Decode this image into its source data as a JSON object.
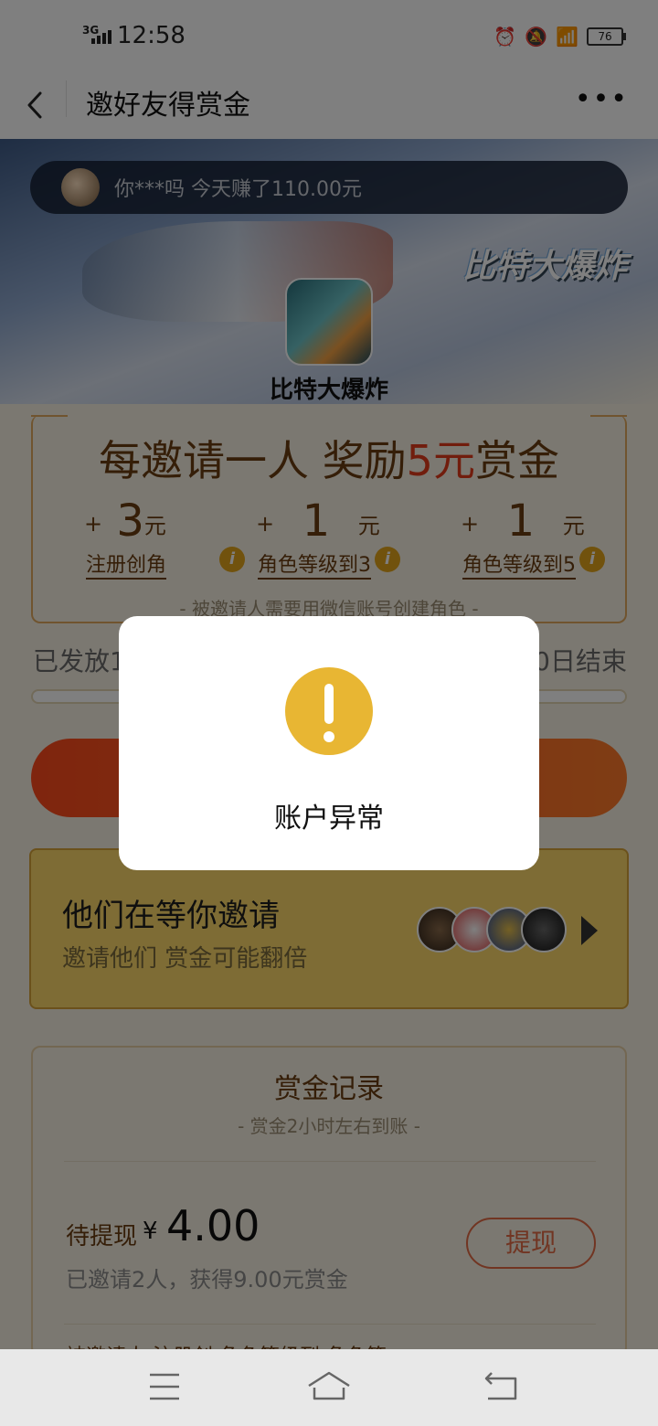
{
  "status_bar": {
    "network": "3G",
    "time": "12:58",
    "battery": "76"
  },
  "nav": {
    "title": "邀好友得赏金",
    "more": "•••"
  },
  "banner": {
    "ticker_text": "你***吗 今天赚了110.00元",
    "game_logo_text": "比特大爆炸",
    "app_name": "比特大爆炸"
  },
  "reward": {
    "headline_pre": "每邀请一人 奖励",
    "headline_amount": "5元",
    "headline_post": "赏金",
    "items": [
      {
        "plus": "+",
        "amount": "3",
        "unit": "元",
        "label": "注册创角"
      },
      {
        "plus": "+",
        "amount": "1",
        "unit": "元",
        "label": "角色等级到3"
      },
      {
        "plus": "+",
        "amount": "1",
        "unit": "元",
        "label": "角色等级到5"
      }
    ],
    "info_glyph": "i",
    "note": "- 被邀请人需要用微信账号创建角色 -"
  },
  "progress": {
    "left_text": "已发放1",
    "right_text": "0日结束"
  },
  "waiting": {
    "title": "他们在等你邀请",
    "subtitle": "邀请他们 赏金可能翻倍"
  },
  "records": {
    "title": "赏金记录",
    "subtitle": "- 赏金2小时左右到账 -",
    "pending_label": "待提现",
    "currency": "¥",
    "pending_amount": "4.00",
    "summary": "已邀请2人，获得9.00元赏金",
    "withdraw_label": "提现",
    "headers_partial": "被邀请人          注册创     角色等级到     角色等"
  },
  "modal": {
    "message": "账户异常"
  },
  "colors": {
    "accent": "#e23b1b",
    "warn": "#e8b633",
    "brown": "#6b3d10"
  }
}
